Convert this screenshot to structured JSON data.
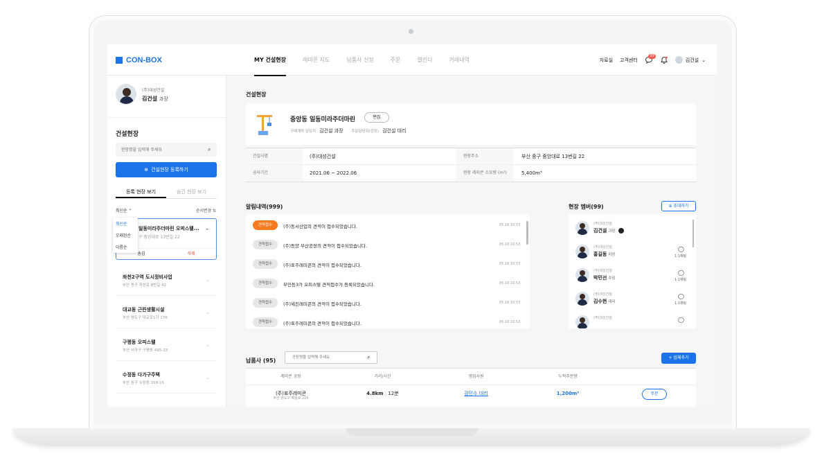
{
  "brand": {
    "name": "CON-BOX",
    "accent": "#1a73e8"
  },
  "nav": {
    "items": [
      "MY 건설현장",
      "레미콘 지도",
      "납품사 선정",
      "주문",
      "캘린더",
      "거래내역"
    ],
    "active": "MY 건설현장"
  },
  "header_right": {
    "links": [
      "자료실",
      "고객센터"
    ],
    "chat_badge": "99",
    "user": "김건설"
  },
  "profile": {
    "company": "(주)대성건설",
    "name": "김건설",
    "rank": "과장"
  },
  "sidebar": {
    "title": "건설현장",
    "search_placeholder": "현장명을 입력해 주세요",
    "register_label": "건설현장 등록하기",
    "tabs": [
      "등록 현장 보기",
      "숨긴 현장 보기"
    ],
    "sort_label": "최신순",
    "sort_right": "순서변경",
    "sort_options": [
      "최신순",
      "오래된순",
      "이름순"
    ],
    "active_site": {
      "title": "일동미라주더마린 오피스텔...",
      "addr": "구 중앙대로 13번길 22",
      "hide": "숨김",
      "delete": "삭제"
    },
    "sites": [
      {
        "title": "좌천2구역 도시정비사업",
        "addr": "부산 동구 자성로 8번길 42"
      },
      {
        "title": "대교동 근린생활시설",
        "addr": "부산 영도구 대교로1가 176"
      },
      {
        "title": "구평동 오피스텔",
        "addr": "부산 사하구 구평동 495-23"
      },
      {
        "title": "수정동 다가구주택",
        "addr": "부산 동구 수정동 358-15"
      }
    ]
  },
  "site": {
    "section_title": "건설현장",
    "name": "중앙동 일동미라주더마린",
    "edit": "편집",
    "purchaser_label": "구매계약 담당자",
    "purchaser": "김건설 과장",
    "orderer_label": "주문담당자(현장)",
    "orderer": "김건설 대리",
    "info": {
      "builder_label": "건설사명",
      "builder": "(주)대성건설",
      "address_label": "현장주소",
      "address": "부산 중구 중앙대로 13번길 22",
      "period_label": "공사기간",
      "period": "2021.06 ~ 2022.06",
      "volume_label": "현장 레미콘 소모량 (m³)",
      "volume": "5,400m³"
    }
  },
  "alerts": {
    "title": "알림내역(999)",
    "items": [
      {
        "tag": "견적접수",
        "hot": true,
        "text": "(주)동서산업의 견적이 접수되었습니다.",
        "time": "05.18 10:53"
      },
      {
        "tag": "견적접수",
        "hot": false,
        "text": "(주)동양 부산공장의 견적이 접수되었습니다.",
        "time": "05.18 10:53"
      },
      {
        "tag": "견적접수",
        "hot": false,
        "text": "(주)표주레미콘의 견적이 접수되었습니다.",
        "time": "05.18 10:53"
      },
      {
        "tag": "견적접수",
        "hot": false,
        "text": "부민동3가 오피스텔 견적접수가 등록되었습니다.",
        "time": "05.18 10:53"
      },
      {
        "tag": "견적접수",
        "hot": false,
        "text": "(주)세진레미콘의 견적이 접수되었습니다.",
        "time": "05.18 10:53"
      },
      {
        "tag": "견적접수",
        "hot": false,
        "text": "(주)표주레미콘의 견적이 접수되었습니다.",
        "time": "05.18 10:53"
      }
    ]
  },
  "members": {
    "title": "현장 멤버(99)",
    "invite": "초대하기",
    "items": [
      {
        "company": "(주)대성건설",
        "name": "김건설",
        "rank": "과장",
        "chat": ""
      },
      {
        "company": "(주)대성건설",
        "name": "홍길동",
        "rank": "차장",
        "chat": "1:1채팅"
      },
      {
        "company": "(주)대성건설",
        "name": "박민선",
        "rank": "주임",
        "chat": "1:1채팅"
      },
      {
        "company": "(주)대성건설",
        "name": "김수현",
        "rank": "대리",
        "chat": "1:1채팅"
      },
      {
        "company": "(주)대성건설",
        "name": "",
        "rank": "",
        "chat": ""
      }
    ]
  },
  "suppliers": {
    "title": "납품사 (95)",
    "search_placeholder": "공장명을 입력해 주세요",
    "add_label": "업체추가",
    "headers": [
      "레미콘 공장",
      "거리/시간",
      "영업사원",
      "누적주문량",
      ""
    ],
    "rows": [
      {
        "name": "(주)표주레미콘",
        "addr": "부산 영도구 해광로 225",
        "distance": "4.8km",
        "time": "12분",
        "sales": "김민수 대리",
        "total": "1,200m³",
        "action": "주문"
      }
    ]
  }
}
